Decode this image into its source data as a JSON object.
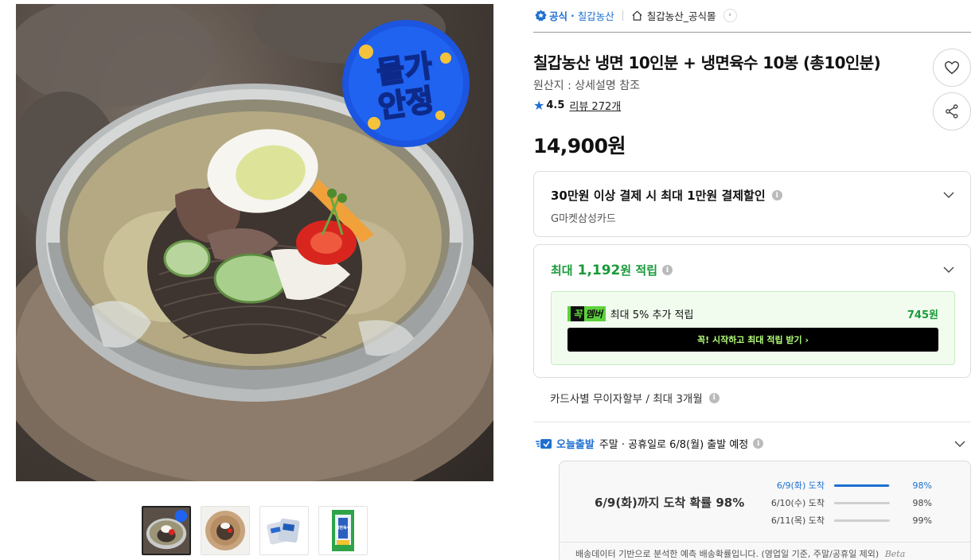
{
  "store": {
    "official_label": "공식",
    "store_name": "칠갑농산",
    "shop_link": "칠갑농산_공식몰"
  },
  "product": {
    "title": "칠갑농산 냉면 10인분 + 냉면육수 10봉 (총10인분)",
    "origin": "원산지 : 상세설명 참조",
    "rating": "4.5",
    "reviews": "리뷰 272개",
    "price": "14,900원",
    "promo_badge": [
      "물가",
      "안정"
    ]
  },
  "thumbnails": [
    {
      "name": "thumb-naengmyeon-bowl"
    },
    {
      "name": "thumb-noodle-plate"
    },
    {
      "name": "thumb-broth-packs"
    },
    {
      "name": "thumb-package"
    }
  ],
  "thumb_package_label": "냉면육수",
  "discount": {
    "title": "30만원 이상 결제 시 최대 1만원 결제할인",
    "card": "G마켓삼성카드"
  },
  "reward": {
    "prefix": "최대",
    "amount": "1,192",
    "suffix": "원 적립",
    "member_tag_k": "꼭",
    "member_tag": "멤버",
    "member_text": "최대 5% 추가 적립",
    "member_points": "745원",
    "cta": "꼭! 시작하고 최대 적립 받기 ›"
  },
  "installment": "카드사별 무이자할부 / 최대 3개월",
  "shipping": {
    "badge": "오늘출발",
    "text": "주말 · 공휴일로 6/8(월) 출발 예정",
    "headline": "6/9(화)까지 도착 확률 98%",
    "probabilities": [
      {
        "date": "6/9(화) 도착",
        "percent": "98%",
        "value": 0.98
      },
      {
        "date": "6/10(수) 도착",
        "percent": "98%",
        "value": 0.98
      },
      {
        "date": "6/11(목) 도착",
        "percent": "99%",
        "value": 0.99
      }
    ],
    "footnote": "배송데이터 기반으로 분석한 예측 배송확률입니다. (영업일 기준, 주말/공휴일 제외)",
    "beta": "Beta"
  },
  "colors": {
    "accent_blue": "#1c6fd1",
    "reward_green": "#1a9a3a",
    "member_green": "#5dd23c"
  }
}
